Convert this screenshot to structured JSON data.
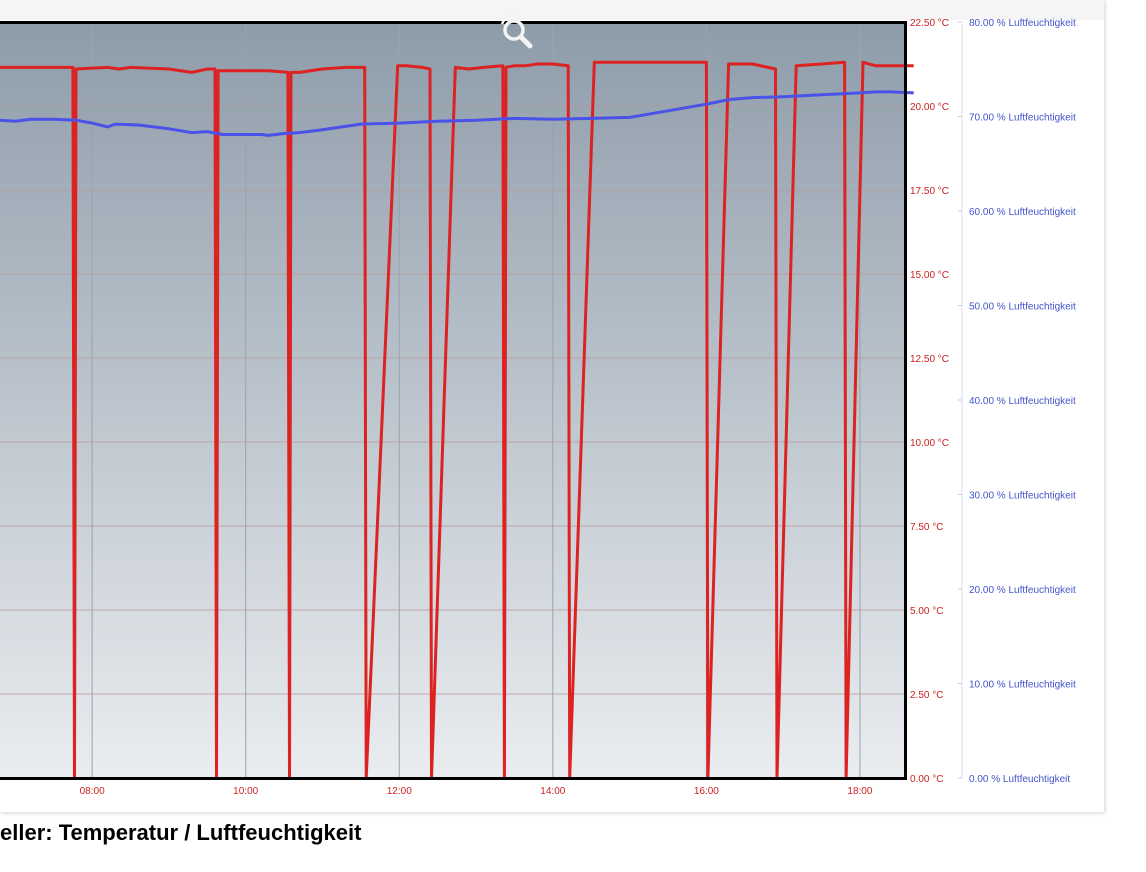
{
  "caption": "eller: Temperatur / Luftfeuchtigkeit",
  "zoom_icon": "magnifier-reset-icon",
  "chart_data": {
    "type": "line",
    "title": "eller: Temperatur / Luftfeuchtigkeit",
    "x_axis": {
      "unit": "hour",
      "range": [
        6.8,
        18.6
      ],
      "ticks": [
        8,
        10,
        12,
        14,
        16,
        18
      ],
      "tick_labels": [
        "08:00",
        "10:00",
        "12:00",
        "14:00",
        "16:00",
        "18:00"
      ],
      "grid": true
    },
    "y_axis_left": {
      "position": "right-inner",
      "range": [
        0,
        22.5
      ],
      "ticks": [
        0,
        2.5,
        5,
        7.5,
        10,
        12.5,
        15,
        17.5,
        20,
        22.5
      ],
      "tick_labels": [
        "0.00 °C",
        "2.50 °C",
        "5.00 °C",
        "7.50 °C",
        "10.00 °C",
        "12.50 °C",
        "15.00 °C",
        "17.50 °C",
        "20.00 °C",
        "22.50 °C"
      ],
      "color": "#cc2222",
      "grid": true
    },
    "y_axis_right": {
      "position": "right-outer",
      "range": [
        0,
        80
      ],
      "ticks": [
        0,
        10,
        20,
        30,
        40,
        50,
        60,
        70,
        80
      ],
      "tick_labels": [
        "0.00 % Luftfeuchtigkeit",
        "10.00 % Luftfeuchtigkeit",
        "20.00 % Luftfeuchtigkeit",
        "30.00 % Luftfeuchtigkeit",
        "40.00 % Luftfeuchtigkeit",
        "50.00 % Luftfeuchtigkeit",
        "60.00 % Luftfeuchtigkeit",
        "70.00 % Luftfeuchtigkeit",
        "80.00 % Luftfeuchtigkeit"
      ],
      "color": "#4455cc"
    },
    "series": [
      {
        "axis": "left",
        "color": "#dd2222",
        "x": [
          6.8,
          7.75,
          7.77,
          7.79,
          8.2,
          8.35,
          8.5,
          9.0,
          9.3,
          9.5,
          9.6,
          9.62,
          9.64,
          9.7,
          10.0,
          10.3,
          10.55,
          10.57,
          10.59,
          10.7,
          11.0,
          11.3,
          11.55,
          11.57,
          11.98,
          12.1,
          12.3,
          12.4,
          12.42,
          12.73,
          12.9,
          13.1,
          13.35,
          13.37,
          13.39,
          13.5,
          13.65,
          13.8,
          14.0,
          14.2,
          14.22,
          14.54,
          15.0,
          15.5,
          16.0,
          16.02,
          16.29,
          16.6,
          16.9,
          16.92,
          17.17,
          17.5,
          17.8,
          17.82,
          18.04,
          18.2,
          18.4,
          18.7
        ],
        "values": [
          21.15,
          21.15,
          0.0,
          21.1,
          21.15,
          21.1,
          21.15,
          21.1,
          21.0,
          21.1,
          21.1,
          0.0,
          21.05,
          21.05,
          21.05,
          21.05,
          21.0,
          0.0,
          21.0,
          21.0,
          21.1,
          21.15,
          21.15,
          0.0,
          21.2,
          21.2,
          21.15,
          21.1,
          0.0,
          21.15,
          21.1,
          21.15,
          21.2,
          0.0,
          21.15,
          21.2,
          21.2,
          21.25,
          21.25,
          21.2,
          0.0,
          21.3,
          21.3,
          21.3,
          21.3,
          0.0,
          21.25,
          21.25,
          21.1,
          0.0,
          21.2,
          21.25,
          21.3,
          0.0,
          21.3,
          21.2,
          21.2,
          21.2
        ]
      },
      {
        "axis": "right",
        "color": "#4a52e8",
        "x": [
          6.8,
          7.0,
          7.2,
          7.5,
          7.8,
          8.0,
          8.2,
          8.3,
          8.6,
          9.0,
          9.3,
          9.5,
          9.7,
          10.0,
          10.2,
          10.3,
          10.5,
          10.7,
          11.0,
          11.5,
          12.0,
          12.5,
          13.0,
          13.5,
          14.0,
          14.5,
          15.0,
          15.5,
          16.0,
          16.3,
          16.6,
          17.0,
          17.5,
          18.0,
          18.2,
          18.4,
          18.7
        ],
        "values": [
          69.6,
          69.5,
          69.7,
          69.7,
          69.6,
          69.3,
          68.9,
          69.2,
          69.1,
          68.7,
          68.3,
          68.4,
          68.1,
          68.1,
          68.1,
          68.0,
          68.2,
          68.3,
          68.6,
          69.2,
          69.3,
          69.5,
          69.6,
          69.8,
          69.7,
          69.8,
          69.9,
          70.6,
          71.3,
          71.8,
          72.0,
          72.1,
          72.3,
          72.5,
          72.6,
          72.6,
          72.5
        ]
      }
    ]
  }
}
